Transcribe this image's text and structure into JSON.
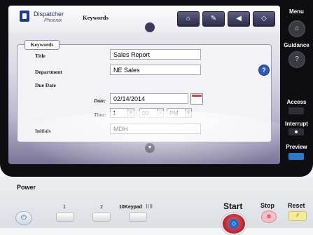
{
  "app": {
    "brand_name": "Dispatcher",
    "brand_sub": "Phoenix",
    "screen_title": "Keywords"
  },
  "toolbar": {
    "buttons": [
      {
        "icon": "home-icon",
        "glyph": "⌂"
      },
      {
        "icon": "edit-card-icon",
        "glyph": "✎"
      },
      {
        "icon": "back-arrow-icon",
        "glyph": "◀"
      },
      {
        "icon": "diamond-icon",
        "glyph": "◇"
      }
    ]
  },
  "form": {
    "group_title": "Keywords",
    "title_label": "Title",
    "title_value": "Sales Report",
    "department_label": "Department",
    "department_value": "NE Sales",
    "due_date_label": "Due Date",
    "date_label": "Date:",
    "date_value": "02/14/2014",
    "time_label": "Time:",
    "hour_value": "1",
    "minute_value": "00",
    "time_sep": ":",
    "ampm_value": "PM",
    "initials_label": "Initials",
    "initials_value": "MDH",
    "help_glyph": "?"
  },
  "sidebar": {
    "menu_label": "Menu",
    "menu_glyph": "⌂",
    "guidance_label": "Guidance",
    "guidance_glyph": "?",
    "access_label": "Access",
    "interrupt_label": "Interrupt",
    "preview_label": "Preview"
  },
  "hardware": {
    "power_label": "Power",
    "power_glyph": "⏻",
    "key1_label": "1",
    "key2_label": "2",
    "keypad_label": "10Keypad",
    "start_label": "Start",
    "start_glyph": "◇",
    "stop_label": "Stop",
    "stop_glyph": "⊗",
    "reset_label": "Reset",
    "reset_glyph": "⁄⁄"
  },
  "colors": {
    "accent": "#2b5bb6",
    "start_red": "#b1202f",
    "preview_led": "#2d79c9",
    "reset_yellow": "#f6ec96"
  }
}
